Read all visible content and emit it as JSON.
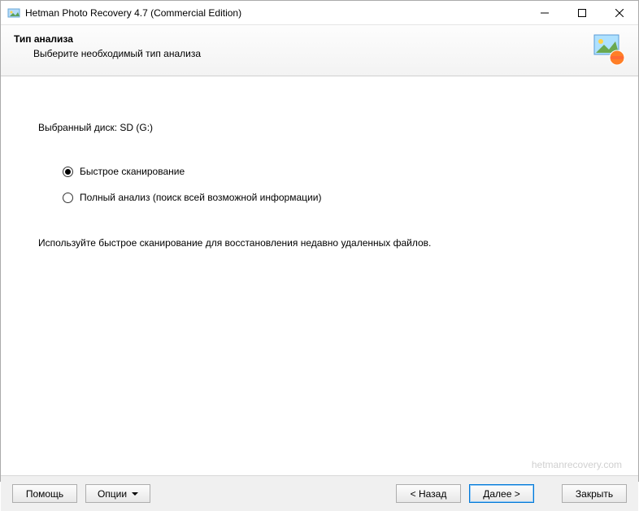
{
  "titlebar": {
    "title": "Hetman Photo Recovery 4.7 (Commercial Edition)"
  },
  "header": {
    "heading": "Тип анализа",
    "subtitle": "Выберите необходимый тип анализа"
  },
  "content": {
    "selected_disk_label": "Выбранный диск: SD (G:)",
    "options": [
      {
        "label": "Быстрое сканирование",
        "checked": true
      },
      {
        "label": "Полный анализ (поиск всей возможной информации)",
        "checked": false
      }
    ],
    "hint": "Используйте быстрое сканирование для восстановления недавно удаленных файлов."
  },
  "watermark": "hetmanrecovery.com",
  "footer": {
    "help": "Помощь",
    "options": "Опции",
    "back": "< Назад",
    "next": "Далее >",
    "close": "Закрыть"
  }
}
